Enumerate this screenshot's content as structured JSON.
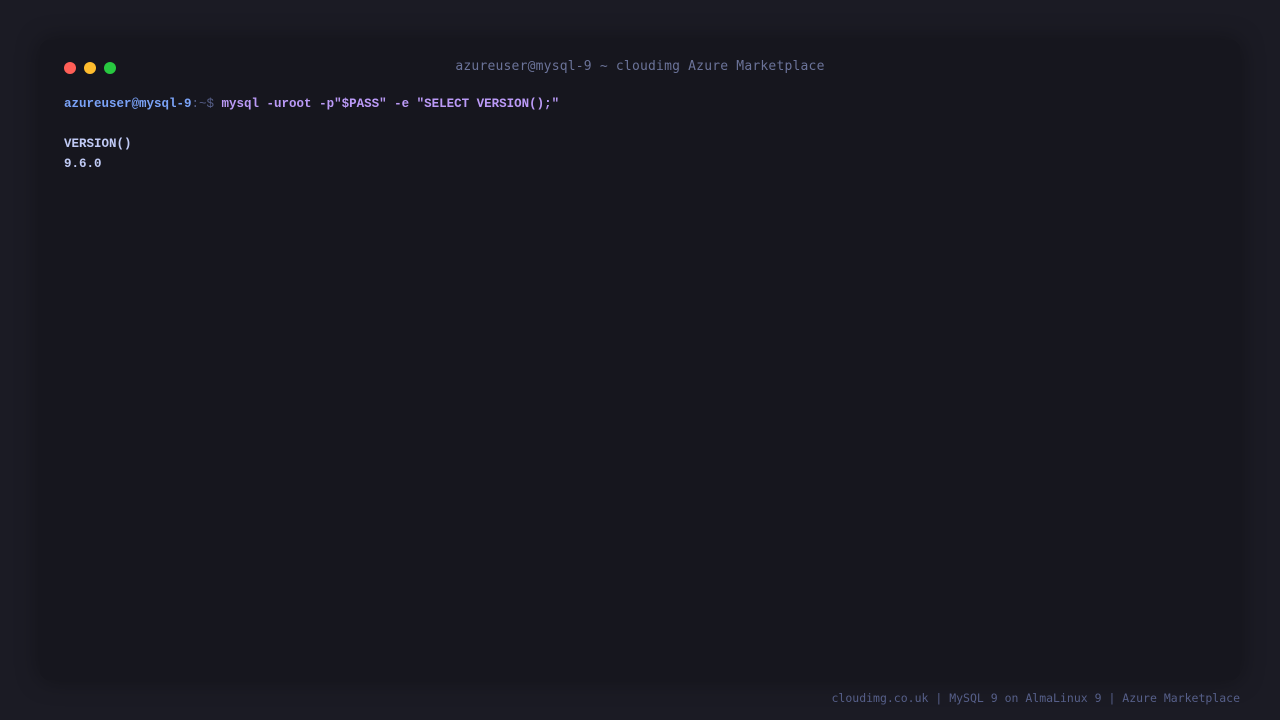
{
  "window": {
    "title": "azureuser@mysql-9 ~ cloudimg Azure Marketplace"
  },
  "terminal": {
    "prompt_user": "azureuser@mysql-9",
    "prompt_path": ":~$ ",
    "command": "mysql -uroot -p\"$PASS\" -e \"SELECT VERSION();\"",
    "output_header": "VERSION()",
    "output_value": "9.6.0"
  },
  "footer": {
    "text": "cloudimg.co.uk | MySQL 9 on AlmaLinux 9 | Azure Marketplace"
  },
  "colors": {
    "background": "#1b1b24",
    "terminal_bg": "#16161e",
    "prompt_user": "#7aa2f7",
    "command": "#bb9af7",
    "output": "#c0caf5",
    "close_dot": "#ff5f57",
    "minimize_dot": "#febc2e",
    "maximize_dot": "#28c840"
  }
}
